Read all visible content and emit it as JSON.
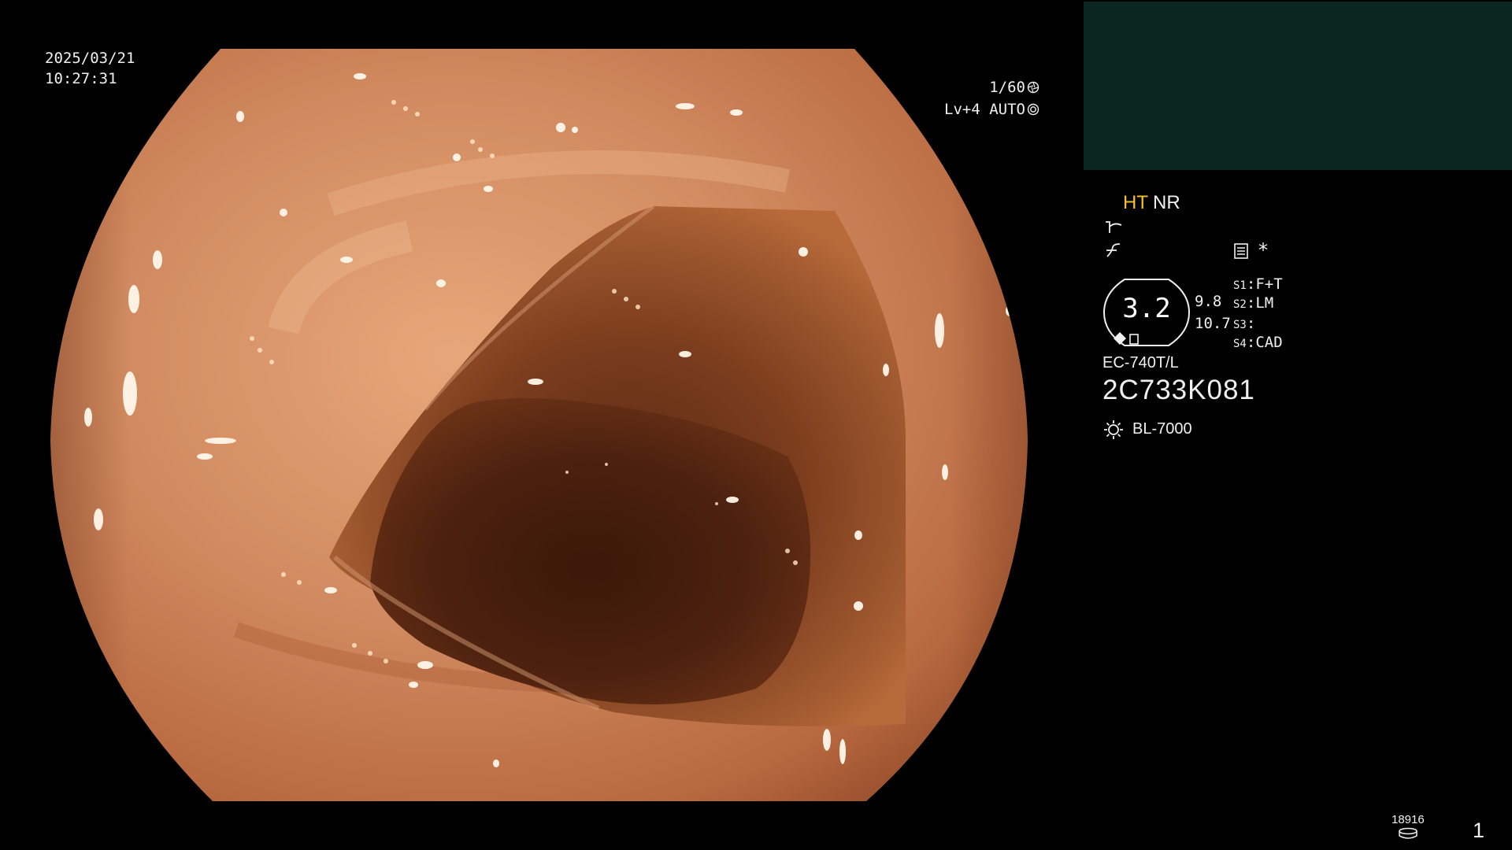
{
  "overlay": {
    "date": "2025/03/21",
    "time": "10:27:31",
    "shutter": "1/60",
    "shutter_icon": "aperture-icon",
    "iris": "Lv+4 AUTO",
    "iris_icon": "auto-iris-icon"
  },
  "panel": {
    "thumbnail_color": "#0b2521",
    "mode_ht": "HT",
    "mode_nr": "NR",
    "mode_ht_color": "#f6c42a",
    "icons": [
      "tone-curve-icon",
      "enhancement-curve-icon",
      "document-icon",
      "asterisk-icon",
      "light-source-icon",
      "storage-disk-icon"
    ],
    "asterisk": "*",
    "magnification": "3.2",
    "zoom_a": "9.8",
    "zoom_b": "10.7",
    "switches": [
      {
        "key": "S1",
        "value": "F+T"
      },
      {
        "key": "S2",
        "value": "LM"
      },
      {
        "key": "S3",
        "value": ""
      },
      {
        "key": "S4",
        "value": "CAD"
      }
    ],
    "scope_model": "EC-740T/L",
    "scope_serial": "2C733K081",
    "light_source": "BL-7000",
    "counter": "18916",
    "page_number": "1"
  }
}
